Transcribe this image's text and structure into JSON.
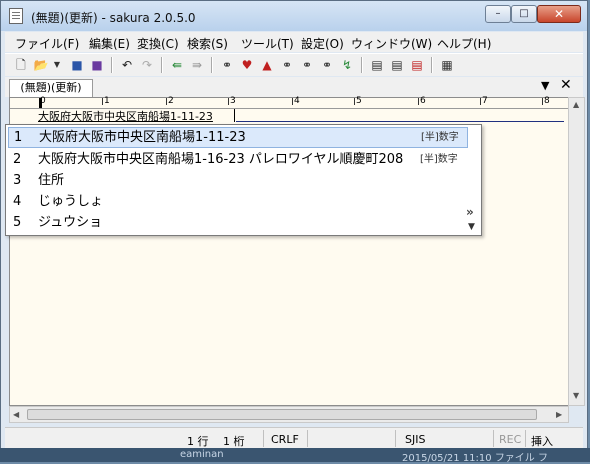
{
  "window": {
    "title": "(無題)(更新) - sakura 2.0.5.0"
  },
  "window_controls": {
    "minimize": "–",
    "maximize": "□",
    "close": "✕"
  },
  "menu": [
    "ファイル(F)",
    "編集(E)",
    "変換(C)",
    "検索(S)",
    "ツール(T)",
    "設定(O)",
    "ウィンドウ(W)",
    "ヘルプ(H)"
  ],
  "toolbar": {
    "icons": [
      "new-file-icon",
      "open-file-icon",
      "dropdown-arrow-icon",
      "save-icon",
      "save-all-icon",
      "undo-icon",
      "redo-icon",
      "jump-back-icon",
      "jump-forward-icon",
      "search-binoculars-icon",
      "search-up-icon",
      "search-down-icon",
      "search-regex-icon",
      "replace-icon",
      "grep-icon",
      "tag-jump-icon",
      "compare-icon",
      "outline-icon",
      "function-list-icon",
      "settings-icon"
    ]
  },
  "tabs": {
    "active": "(無題)(更新)",
    "dropdown": "▼",
    "close": "✕"
  },
  "ruler": {
    "numbers": [
      "0",
      "1",
      "2",
      "3",
      "4",
      "5",
      "6",
      "7",
      "8"
    ]
  },
  "editor": {
    "line1": "大阪府大阪市中央区南船場1-11-23"
  },
  "completion": {
    "candidates": [
      {
        "num": "1",
        "text": "大阪府大阪市中央区南船場1-11-23",
        "tag": "[半]数字",
        "selected": true
      },
      {
        "num": "2",
        "text": "大阪府大阪市中央区南船場1-16-23 パレロワイヤル順慶町208",
        "tag": "[半]数字",
        "selected": false
      },
      {
        "num": "3",
        "text": "住所",
        "tag": "",
        "selected": false
      },
      {
        "num": "4",
        "text": "じゅうしょ",
        "tag": "",
        "selected": false
      },
      {
        "num": "5",
        "text": "ジュウショ",
        "tag": "",
        "selected": false
      }
    ],
    "expand": "»",
    "scroll_down": "▼"
  },
  "status": {
    "line": "1 行",
    "column": "1 桁",
    "eol": "CRLF",
    "encoding": "SJIS",
    "rec": "REC",
    "insert": "挿入"
  },
  "taskbar": {
    "left": "eaminan",
    "right": "2015/05/21 11:10    ファイル フ"
  }
}
